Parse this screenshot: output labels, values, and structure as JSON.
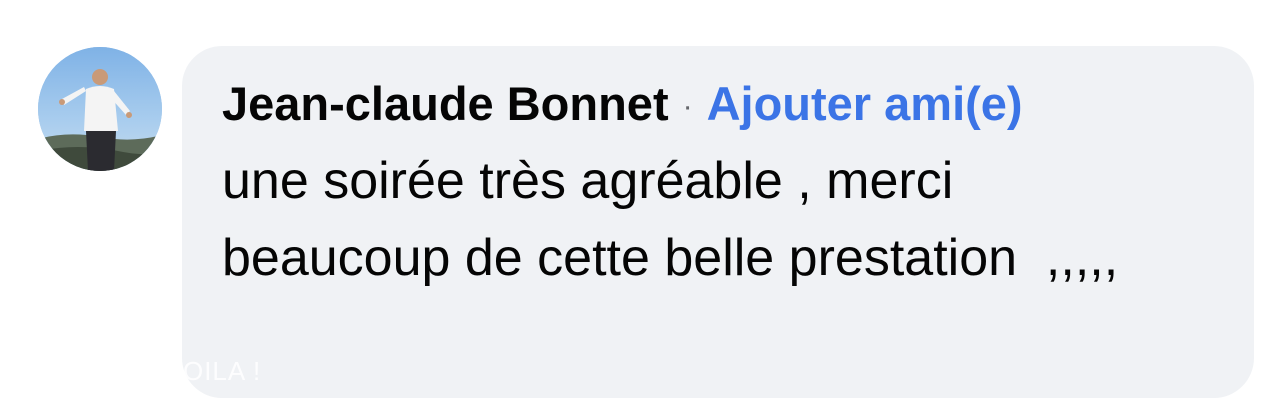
{
  "comment": {
    "author": "Jean-claude Bonnet",
    "separator": "·",
    "add_friend_label": "Ajouter ami(e)",
    "text": "une soirée très agréable , merci beaucoup de cette belle prestation  ,,,,,"
  },
  "watermark": {
    "text": "T VOILA !"
  },
  "colors": {
    "bubble_bg": "#f0f2f5",
    "link_blue": "#3b74e6",
    "text": "#050505",
    "meta_gray": "#65676b"
  },
  "icons": {
    "avatar": "user-photo-avatar"
  }
}
